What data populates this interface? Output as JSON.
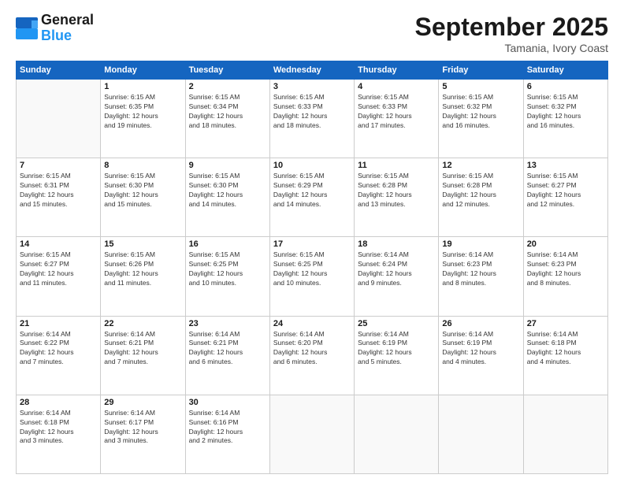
{
  "logo": {
    "line1": "General",
    "line2": "Blue"
  },
  "title": "September 2025",
  "subtitle": "Tamania, Ivory Coast",
  "weekdays": [
    "Sunday",
    "Monday",
    "Tuesday",
    "Wednesday",
    "Thursday",
    "Friday",
    "Saturday"
  ],
  "weeks": [
    [
      {
        "day": "",
        "info": ""
      },
      {
        "day": "1",
        "info": "Sunrise: 6:15 AM\nSunset: 6:35 PM\nDaylight: 12 hours\nand 19 minutes."
      },
      {
        "day": "2",
        "info": "Sunrise: 6:15 AM\nSunset: 6:34 PM\nDaylight: 12 hours\nand 18 minutes."
      },
      {
        "day": "3",
        "info": "Sunrise: 6:15 AM\nSunset: 6:33 PM\nDaylight: 12 hours\nand 18 minutes."
      },
      {
        "day": "4",
        "info": "Sunrise: 6:15 AM\nSunset: 6:33 PM\nDaylight: 12 hours\nand 17 minutes."
      },
      {
        "day": "5",
        "info": "Sunrise: 6:15 AM\nSunset: 6:32 PM\nDaylight: 12 hours\nand 16 minutes."
      },
      {
        "day": "6",
        "info": "Sunrise: 6:15 AM\nSunset: 6:32 PM\nDaylight: 12 hours\nand 16 minutes."
      }
    ],
    [
      {
        "day": "7",
        "info": "Sunrise: 6:15 AM\nSunset: 6:31 PM\nDaylight: 12 hours\nand 15 minutes."
      },
      {
        "day": "8",
        "info": "Sunrise: 6:15 AM\nSunset: 6:30 PM\nDaylight: 12 hours\nand 15 minutes."
      },
      {
        "day": "9",
        "info": "Sunrise: 6:15 AM\nSunset: 6:30 PM\nDaylight: 12 hours\nand 14 minutes."
      },
      {
        "day": "10",
        "info": "Sunrise: 6:15 AM\nSunset: 6:29 PM\nDaylight: 12 hours\nand 14 minutes."
      },
      {
        "day": "11",
        "info": "Sunrise: 6:15 AM\nSunset: 6:28 PM\nDaylight: 12 hours\nand 13 minutes."
      },
      {
        "day": "12",
        "info": "Sunrise: 6:15 AM\nSunset: 6:28 PM\nDaylight: 12 hours\nand 12 minutes."
      },
      {
        "day": "13",
        "info": "Sunrise: 6:15 AM\nSunset: 6:27 PM\nDaylight: 12 hours\nand 12 minutes."
      }
    ],
    [
      {
        "day": "14",
        "info": "Sunrise: 6:15 AM\nSunset: 6:27 PM\nDaylight: 12 hours\nand 11 minutes."
      },
      {
        "day": "15",
        "info": "Sunrise: 6:15 AM\nSunset: 6:26 PM\nDaylight: 12 hours\nand 11 minutes."
      },
      {
        "day": "16",
        "info": "Sunrise: 6:15 AM\nSunset: 6:25 PM\nDaylight: 12 hours\nand 10 minutes."
      },
      {
        "day": "17",
        "info": "Sunrise: 6:15 AM\nSunset: 6:25 PM\nDaylight: 12 hours\nand 10 minutes."
      },
      {
        "day": "18",
        "info": "Sunrise: 6:14 AM\nSunset: 6:24 PM\nDaylight: 12 hours\nand 9 minutes."
      },
      {
        "day": "19",
        "info": "Sunrise: 6:14 AM\nSunset: 6:23 PM\nDaylight: 12 hours\nand 8 minutes."
      },
      {
        "day": "20",
        "info": "Sunrise: 6:14 AM\nSunset: 6:23 PM\nDaylight: 12 hours\nand 8 minutes."
      }
    ],
    [
      {
        "day": "21",
        "info": "Sunrise: 6:14 AM\nSunset: 6:22 PM\nDaylight: 12 hours\nand 7 minutes."
      },
      {
        "day": "22",
        "info": "Sunrise: 6:14 AM\nSunset: 6:21 PM\nDaylight: 12 hours\nand 7 minutes."
      },
      {
        "day": "23",
        "info": "Sunrise: 6:14 AM\nSunset: 6:21 PM\nDaylight: 12 hours\nand 6 minutes."
      },
      {
        "day": "24",
        "info": "Sunrise: 6:14 AM\nSunset: 6:20 PM\nDaylight: 12 hours\nand 6 minutes."
      },
      {
        "day": "25",
        "info": "Sunrise: 6:14 AM\nSunset: 6:19 PM\nDaylight: 12 hours\nand 5 minutes."
      },
      {
        "day": "26",
        "info": "Sunrise: 6:14 AM\nSunset: 6:19 PM\nDaylight: 12 hours\nand 4 minutes."
      },
      {
        "day": "27",
        "info": "Sunrise: 6:14 AM\nSunset: 6:18 PM\nDaylight: 12 hours\nand 4 minutes."
      }
    ],
    [
      {
        "day": "28",
        "info": "Sunrise: 6:14 AM\nSunset: 6:18 PM\nDaylight: 12 hours\nand 3 minutes."
      },
      {
        "day": "29",
        "info": "Sunrise: 6:14 AM\nSunset: 6:17 PM\nDaylight: 12 hours\nand 3 minutes."
      },
      {
        "day": "30",
        "info": "Sunrise: 6:14 AM\nSunset: 6:16 PM\nDaylight: 12 hours\nand 2 minutes."
      },
      {
        "day": "",
        "info": ""
      },
      {
        "day": "",
        "info": ""
      },
      {
        "day": "",
        "info": ""
      },
      {
        "day": "",
        "info": ""
      }
    ]
  ]
}
